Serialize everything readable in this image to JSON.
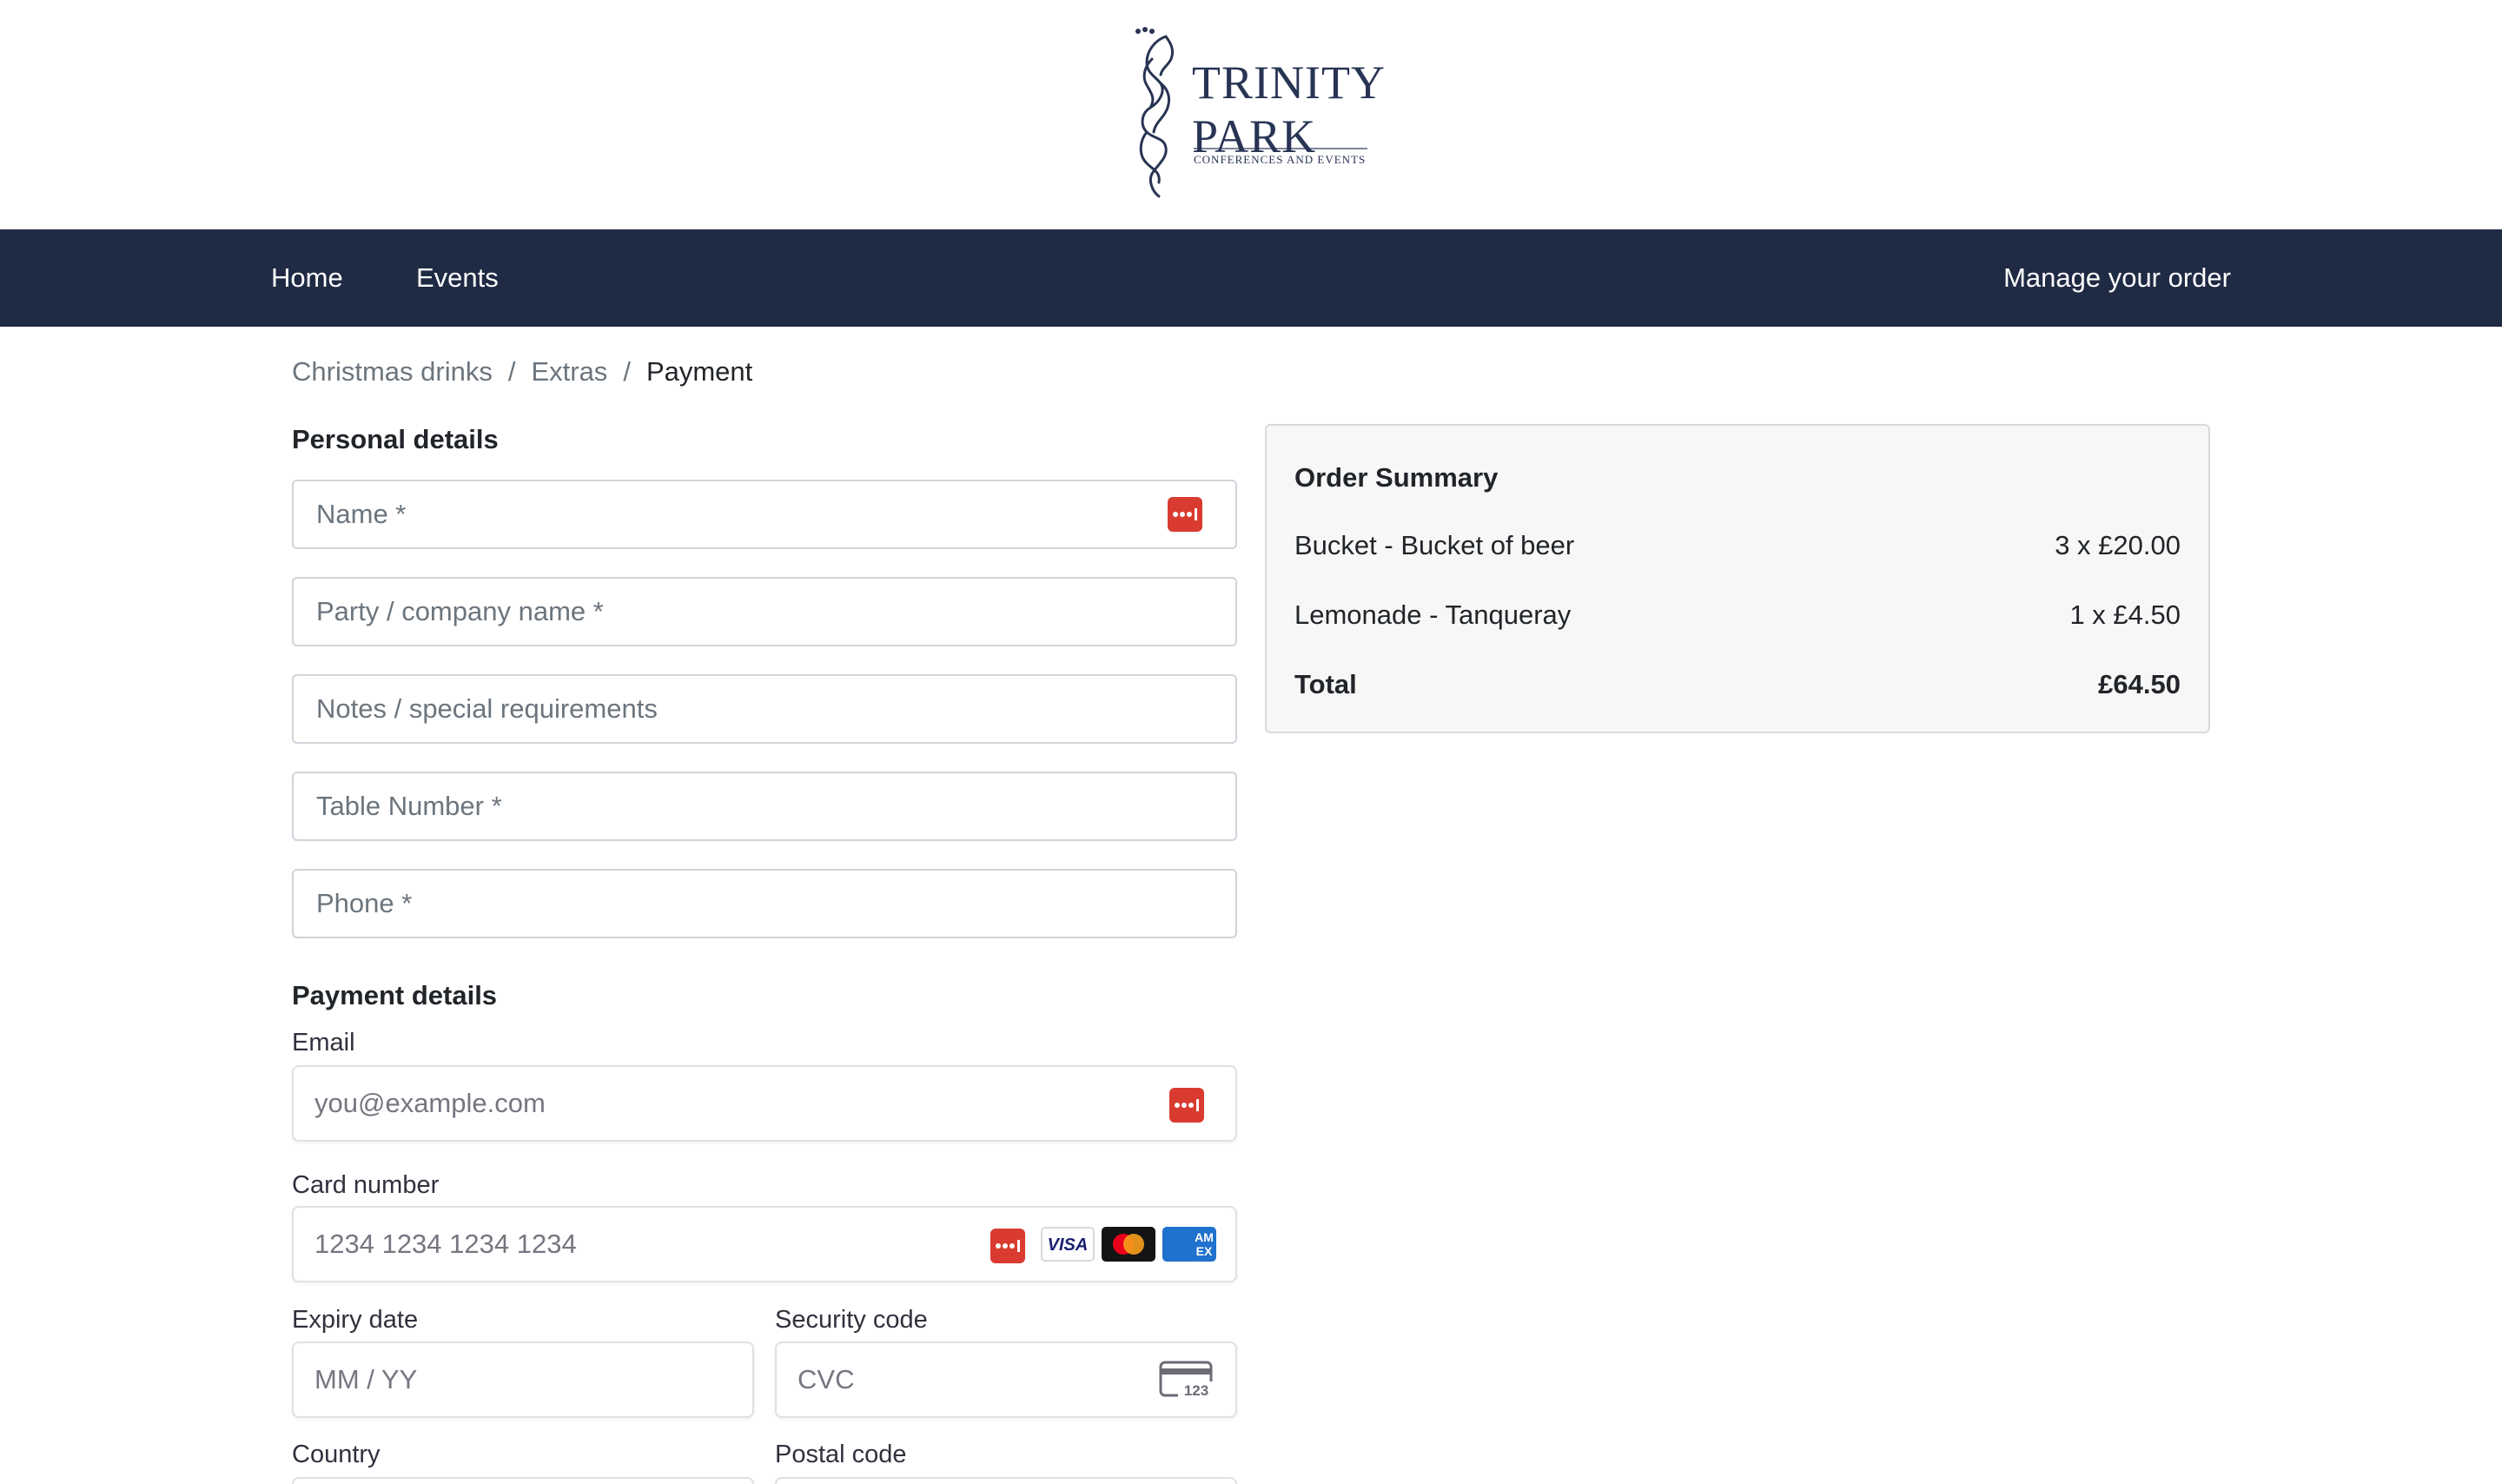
{
  "brand": {
    "line1": "TRINITY",
    "line2": "PARK",
    "tagline": "CONFERENCES AND EVENTS",
    "color": "#283454"
  },
  "nav": {
    "home": "Home",
    "events": "Events",
    "manage": "Manage your order",
    "background": "#1f2a44"
  },
  "breadcrumb": {
    "items": [
      "Christmas drinks",
      "Extras",
      "Payment"
    ],
    "separator": "/"
  },
  "personal": {
    "heading": "Personal details",
    "name_placeholder": "Name *",
    "party_placeholder": "Party / company name *",
    "notes_placeholder": "Notes / special requirements",
    "table_placeholder": "Table Number *",
    "phone_placeholder": "Phone *"
  },
  "payment": {
    "heading": "Payment details",
    "email_label": "Email",
    "email_placeholder": "you@example.com",
    "card_label": "Card number",
    "card_placeholder": "1234 1234 1234 1234",
    "card_brands": [
      "VISA",
      "Mastercard",
      "AMEX"
    ],
    "expiry_label": "Expiry date",
    "expiry_placeholder": "MM / YY",
    "security_label": "Security code",
    "security_placeholder": "CVC",
    "cvc_icon_text": "123",
    "country_label": "Country",
    "postal_label": "Postal code"
  },
  "summary": {
    "title": "Order Summary",
    "items": [
      {
        "name": "Bucket - Bucket of beer",
        "qty_price": "3 x £20.00"
      },
      {
        "name": "Lemonade - Tanqueray",
        "qty_price": "1 x £4.50"
      }
    ],
    "total_label": "Total",
    "total_value": "£64.50"
  },
  "icons": {
    "password_manager": "password-manager-icon",
    "cvc": "card-cvc-icon"
  }
}
